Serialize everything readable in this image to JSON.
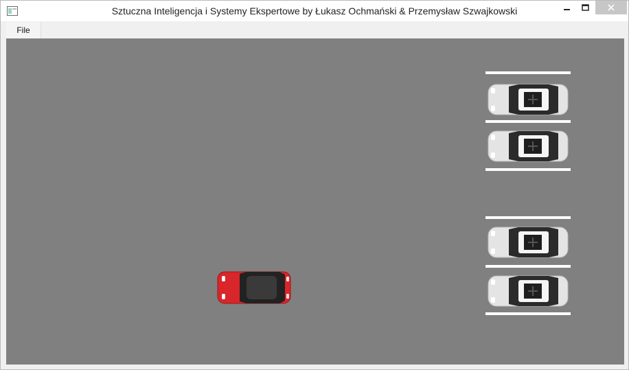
{
  "window": {
    "title": "Sztuczna Inteligencja i Systemy Ekspertowe by Łukasz Ochmański & Przemysław Szwajkowski"
  },
  "menubar": {
    "file_label": "File"
  },
  "scene": {
    "background_color": "#808080",
    "player_car_color": "#d8262a",
    "parked_car_color": "#e4e4e4",
    "parking_line_color": "#ffffff"
  }
}
